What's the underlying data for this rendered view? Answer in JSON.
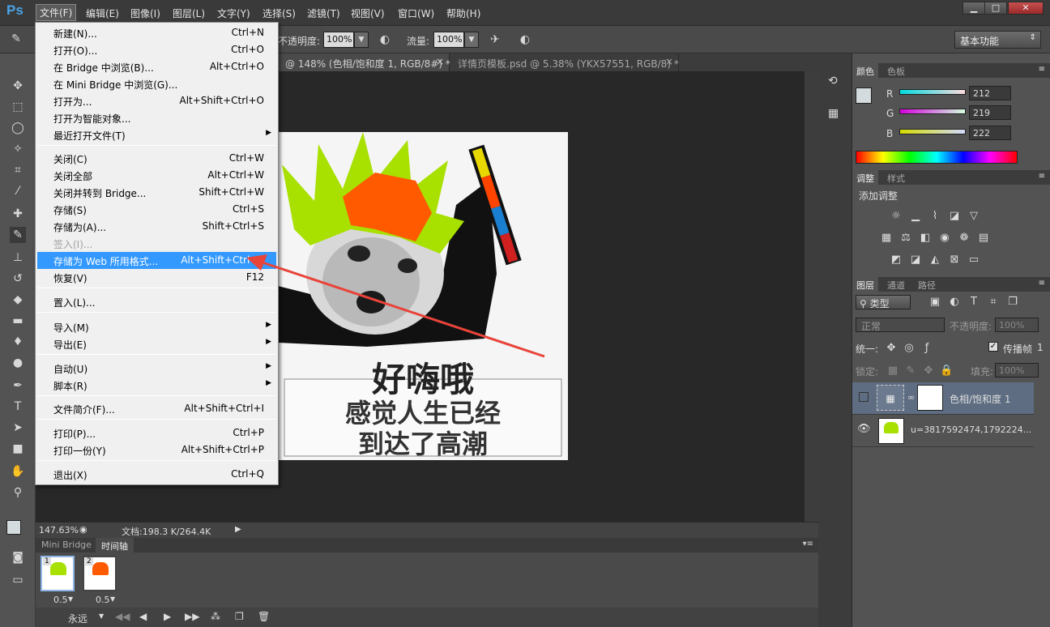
{
  "app": {
    "logo": "Ps"
  },
  "menubar": {
    "items": [
      "文件(F)",
      "编辑(E)",
      "图像(I)",
      "图层(L)",
      "文字(Y)",
      "选择(S)",
      "滤镜(T)",
      "视图(V)",
      "窗口(W)",
      "帮助(H)"
    ],
    "window_controls": [
      "minimize-icon",
      "maximize-icon",
      "close-icon"
    ]
  },
  "options_bar": {
    "opacity_label": "不透明度:",
    "opacity_value": "100%",
    "flow_label": "流量:",
    "flow_value": "100%",
    "workspace": "基本功能"
  },
  "tabs": [
    {
      "label": "@ 148% (色相/饱和度 1, RGB/8#) *"
    },
    {
      "label": "详情页模板.psd @ 5.38% (YKX57551, RGB/8) *"
    }
  ],
  "image_text": {
    "line1": "好嗨哦",
    "line2": "感觉人生已经",
    "line3": "到达了高潮"
  },
  "statusbar": {
    "zoom": "147.63%",
    "doc": "文档:198.3 K/264.4K"
  },
  "timeline": {
    "tabs": [
      "Mini Bridge",
      "时间轴"
    ],
    "frames": [
      {
        "num": "1",
        "delay": "0.5"
      },
      {
        "num": "2",
        "delay": "0.5"
      }
    ],
    "loop": "永远"
  },
  "color_panel": {
    "tabs": [
      "颜色",
      "色板"
    ],
    "r_label": "R",
    "r_value": "212",
    "g_label": "G",
    "g_value": "219",
    "b_label": "B",
    "b_value": "222",
    "fg_color": "#d4dbde"
  },
  "adjust_panel": {
    "tabs": [
      "调整",
      "样式"
    ],
    "title": "添加调整"
  },
  "layers_panel": {
    "tabs": [
      "图层",
      "通道",
      "路径"
    ],
    "filter": "类型",
    "blend_mode": "正常",
    "opacity_label": "不透明度:",
    "opacity_value": "100%",
    "unify_label": "统一:",
    "propagate_label": "传播帧",
    "propagate_value": "1",
    "lock_label": "锁定:",
    "fill_label": "填充:",
    "fill_value": "100%",
    "layers": [
      {
        "name": "色相/饱和度 1"
      },
      {
        "name": "u=3817592474,1792224..."
      }
    ]
  },
  "file_menu": {
    "items": [
      {
        "label": "新建(N)...",
        "shortcut": "Ctrl+N"
      },
      {
        "label": "打开(O)...",
        "shortcut": "Ctrl+O"
      },
      {
        "label": "在 Bridge 中浏览(B)...",
        "shortcut": "Alt+Ctrl+O"
      },
      {
        "label": "在 Mini Bridge 中浏览(G)...",
        "shortcut": ""
      },
      {
        "label": "打开为...",
        "shortcut": "Alt+Shift+Ctrl+O"
      },
      {
        "label": "打开为智能对象...",
        "shortcut": ""
      },
      {
        "label": "最近打开文件(T)",
        "shortcut": ""
      },
      {
        "label": "关闭(C)",
        "shortcut": "Ctrl+W"
      },
      {
        "label": "关闭全部",
        "shortcut": "Alt+Ctrl+W"
      },
      {
        "label": "关闭并转到 Bridge...",
        "shortcut": "Shift+Ctrl+W"
      },
      {
        "label": "存储(S)",
        "shortcut": "Ctrl+S"
      },
      {
        "label": "存储为(A)...",
        "shortcut": "Shift+Ctrl+S"
      },
      {
        "label": "签入(I)...",
        "shortcut": ""
      },
      {
        "label": "存储为 Web 所用格式...",
        "shortcut": "Alt+Shift+Ctrl+S"
      },
      {
        "label": "恢复(V)",
        "shortcut": "F12"
      },
      {
        "label": "置入(L)...",
        "shortcut": ""
      },
      {
        "label": "导入(M)",
        "shortcut": ""
      },
      {
        "label": "导出(E)",
        "shortcut": ""
      },
      {
        "label": "自动(U)",
        "shortcut": ""
      },
      {
        "label": "脚本(R)",
        "shortcut": ""
      },
      {
        "label": "文件简介(F)...",
        "shortcut": "Alt+Shift+Ctrl+I"
      },
      {
        "label": "打印(P)...",
        "shortcut": "Ctrl+P"
      },
      {
        "label": "打印一份(Y)",
        "shortcut": "Alt+Shift+Ctrl+P"
      },
      {
        "label": "退出(X)",
        "shortcut": "Ctrl+Q"
      }
    ]
  }
}
